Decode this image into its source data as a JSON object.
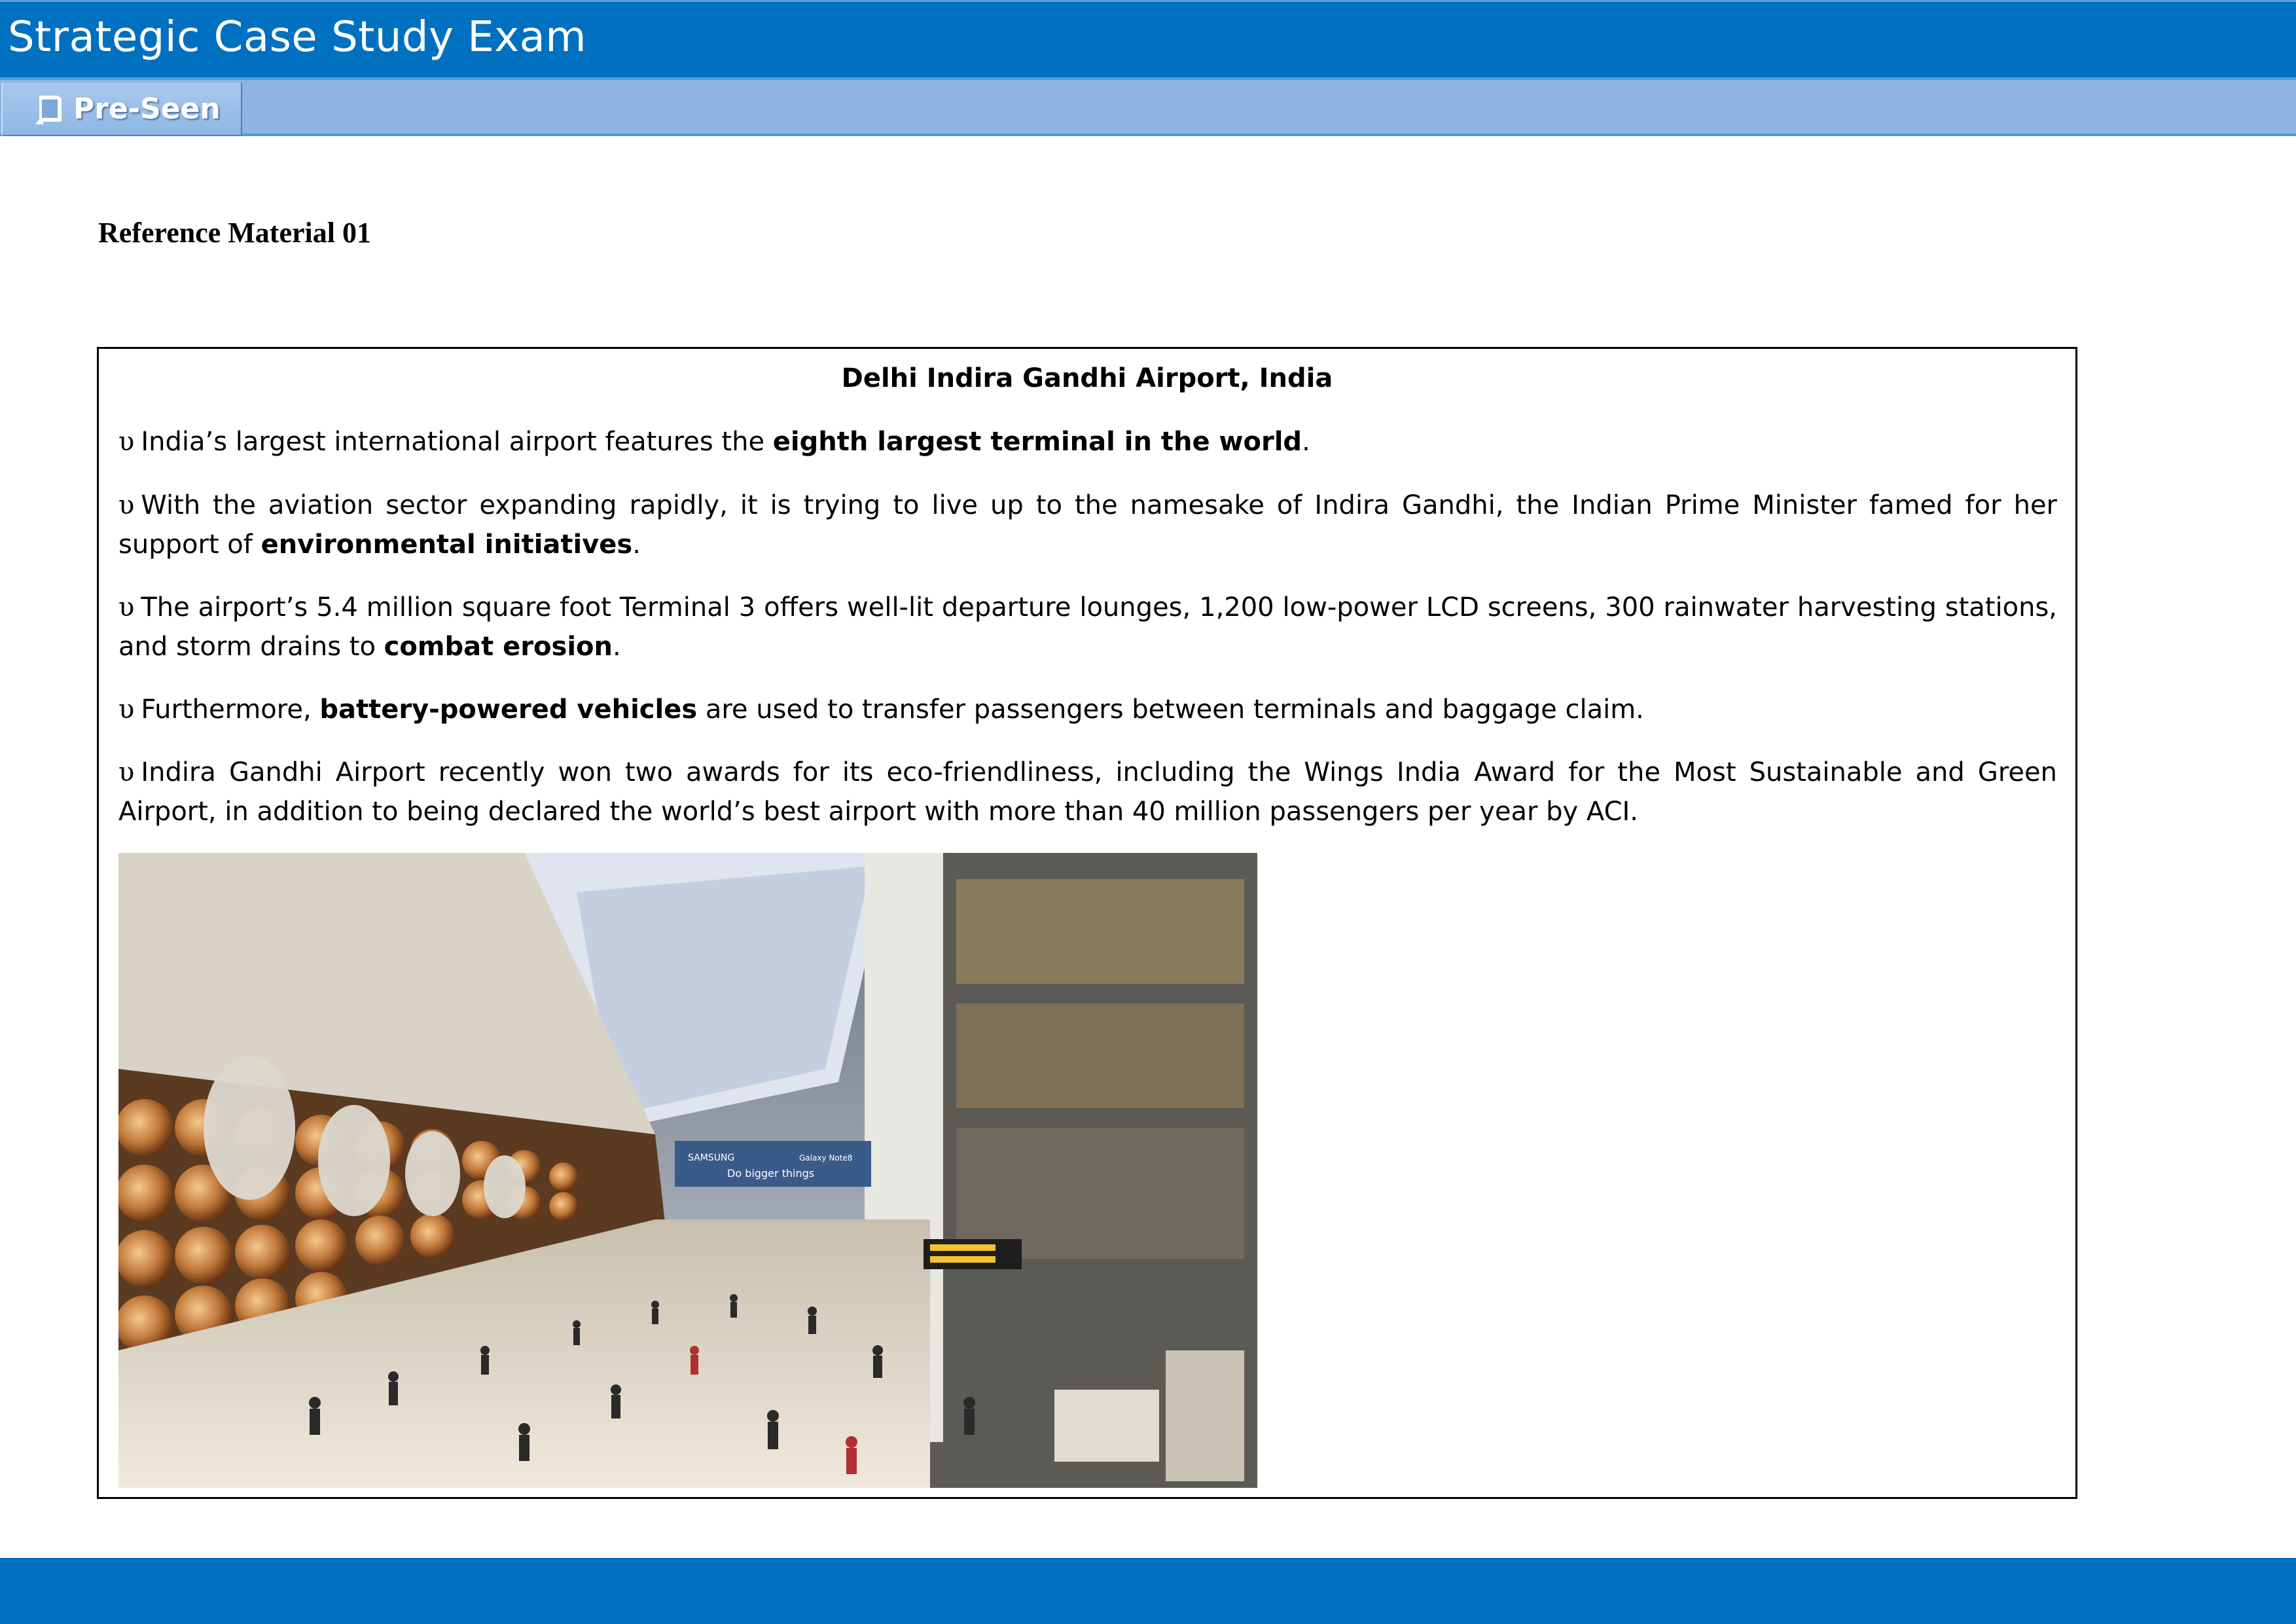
{
  "header": {
    "title": "Strategic Case Study Exam",
    "tab_label": "Pre-Seen",
    "colors": {
      "title_bar": "#0070c0",
      "tab_bar": "#8db4e2"
    }
  },
  "reference_heading": "Reference Material 01",
  "box": {
    "title": "Delhi Indira Gandhi Airport, India",
    "bullet_symbol": "υ",
    "paragraphs": [
      {
        "before": "India’s largest international airport features the ",
        "bold": "eighth largest terminal in the world",
        "after": "."
      },
      {
        "before": "With the aviation sector expanding rapidly, it is trying to live up to the namesake of Indira Gandhi, the Indian Prime Minister famed for her support of ",
        "bold": "environmental initiatives",
        "after": "."
      },
      {
        "before": "The airport’s 5.4 million square foot Terminal 3 offers well-lit departure lounges, 1,200 low-power LCD screens, 300 rainwater harvesting stations, and storm drains to ",
        "bold": "combat erosion",
        "after": "."
      },
      {
        "before": "Furthermore, ",
        "bold": "battery-powered vehicles",
        "after": " are used to transfer passengers between terminals and baggage claim."
      },
      {
        "before": "Indira Gandhi Airport recently won two awards for its eco-friendliness, including the Wings India Award for the Most Sustainable and Green Airport, in addition to being declared the world’s best airport with more than 40 million passengers per year by ACI.",
        "bold": "",
        "after": ""
      }
    ],
    "photo_signs": {
      "banner_brand": "SAMSUNG",
      "banner_text": "Do bigger things",
      "banner_product": "Galaxy Note8"
    }
  }
}
